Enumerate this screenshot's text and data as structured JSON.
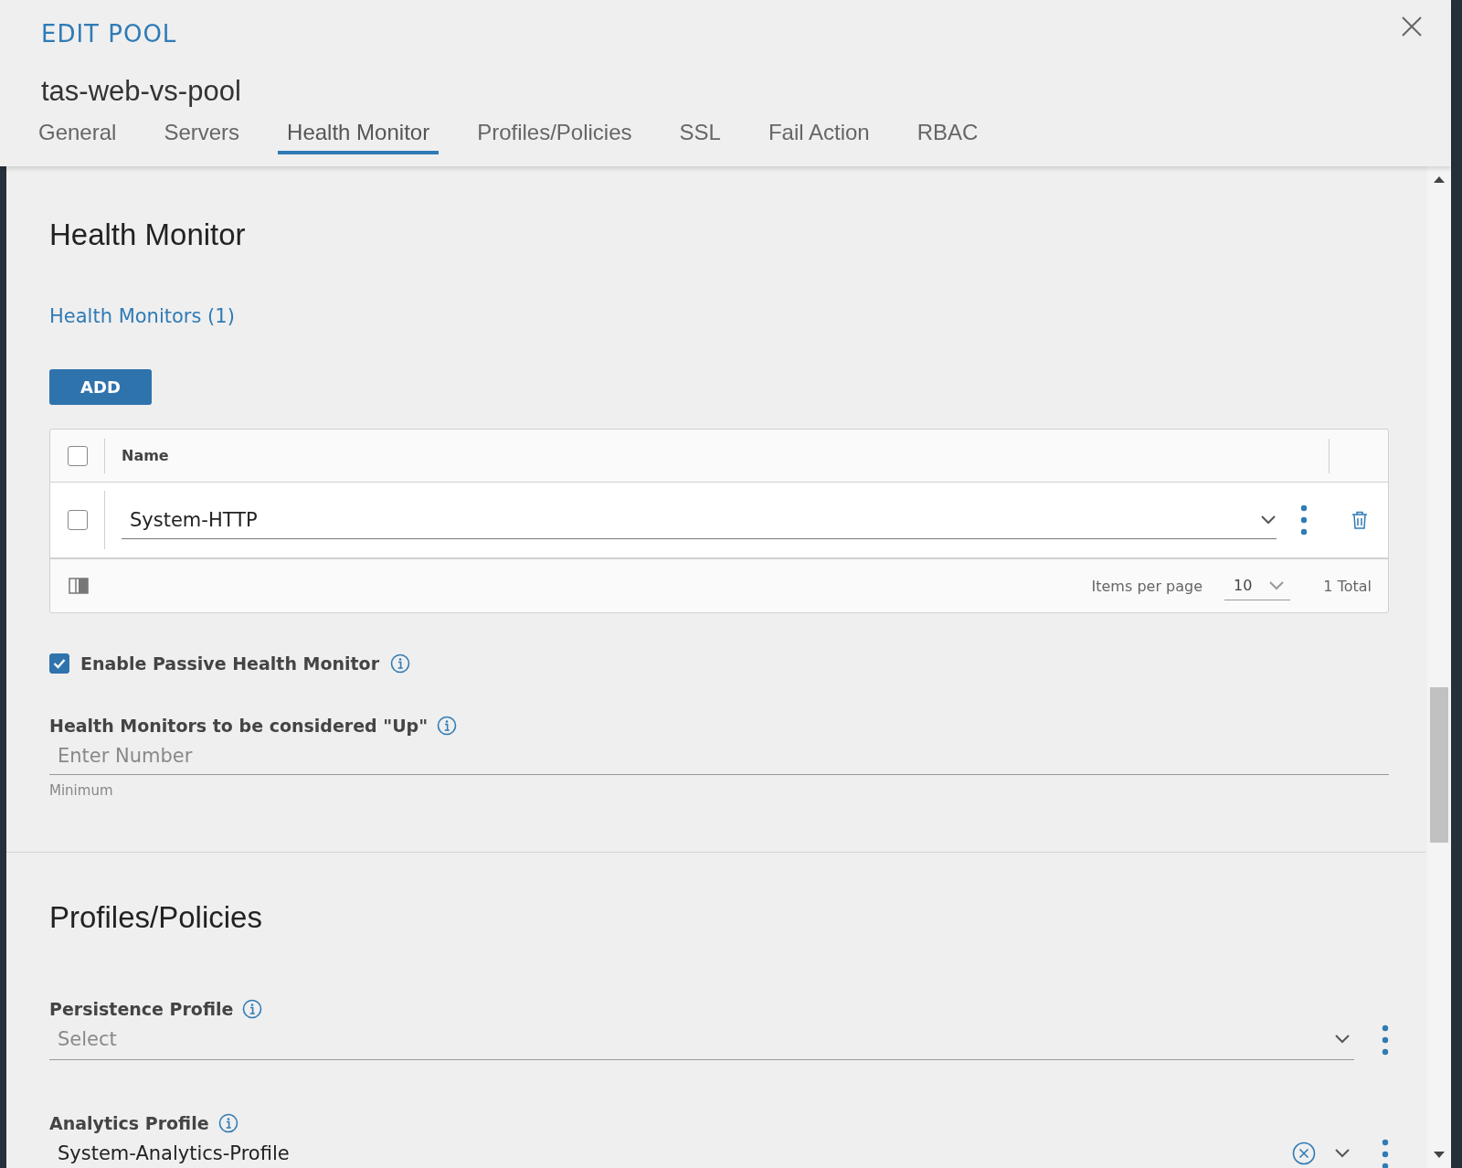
{
  "modal": {
    "title": "EDIT POOL",
    "name": "tas-web-vs-pool"
  },
  "tabs": [
    {
      "label": "General",
      "selected": false
    },
    {
      "label": "Servers",
      "selected": false
    },
    {
      "label": "Health Monitor",
      "selected": true
    },
    {
      "label": "Profiles/Policies",
      "selected": false
    },
    {
      "label": "SSL",
      "selected": false
    },
    {
      "label": "Fail Action",
      "selected": false
    },
    {
      "label": "RBAC",
      "selected": false
    }
  ],
  "health_monitor": {
    "heading": "Health Monitor",
    "list_title": "Health Monitors (1)",
    "add_button": "ADD",
    "table": {
      "columns": [
        "Name"
      ],
      "header_checked": false,
      "rows": [
        {
          "value": "System-HTTP",
          "checked": false
        }
      ],
      "footer": {
        "items_per_page_label": "Items per page",
        "items_per_page": "10",
        "total": "1 Total"
      }
    },
    "passive": {
      "label": "Enable Passive Health Monitor",
      "checked": true
    },
    "up_field": {
      "label": "Health Monitors to be considered \"Up\"",
      "placeholder": "Enter Number",
      "hint": "Minimum"
    }
  },
  "profiles": {
    "heading": "Profiles/Policies",
    "fields": [
      {
        "label": "Persistence Profile",
        "placeholder": "Select",
        "clearable": false
      },
      {
        "label": "Analytics Profile",
        "value": "System-Analytics-Profile",
        "clearable": true
      }
    ]
  }
}
